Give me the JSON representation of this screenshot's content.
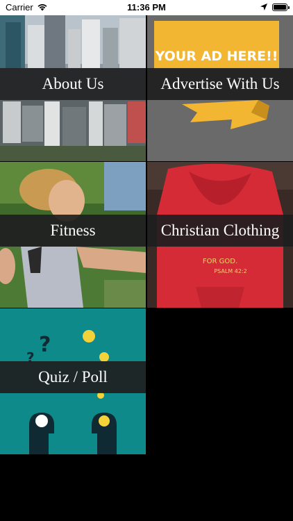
{
  "status_bar": {
    "carrier": "Carrier",
    "time": "11:36 PM",
    "icons": [
      "wifi-icon",
      "location-icon",
      "battery-icon"
    ]
  },
  "tiles": [
    {
      "label": "About Us",
      "image": "city-skyline-image"
    },
    {
      "label": "Advertise With Us",
      "image": "ad-banner-image",
      "ad_text": "YOUR AD HERE!!"
    },
    {
      "label": "Fitness",
      "image": "runner-image"
    },
    {
      "label": "Christian Clothing",
      "image": "red-hoodie-image",
      "print_text_1": "FOR GOD.",
      "print_text_2": "PSALM 42:2"
    },
    {
      "label": "Quiz / Poll",
      "image": "quiz-illustration-image"
    }
  ],
  "colors": {
    "label_band": "#1e1e20",
    "ad_yellow": "#f2b632",
    "hoodie_red": "#d52b36",
    "quiz_teal": "#0e8a8a"
  }
}
